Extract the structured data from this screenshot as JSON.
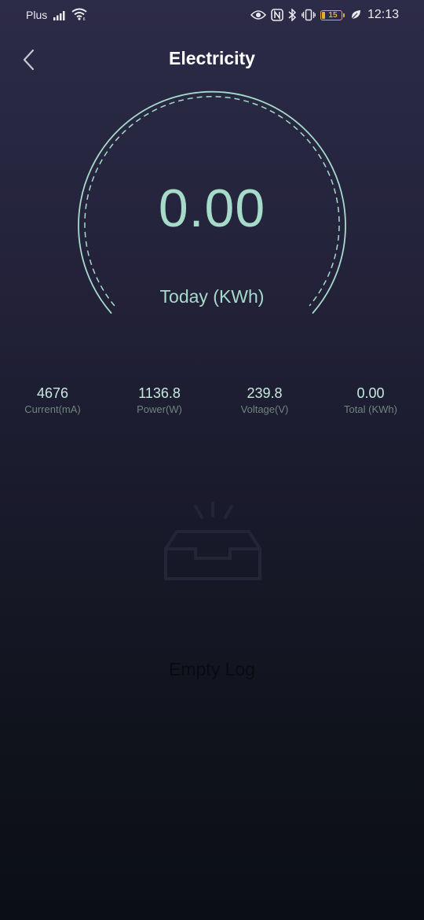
{
  "status_bar": {
    "carrier": "Plus",
    "battery_level": "15",
    "time": "12:13",
    "icons": [
      "signal-icon",
      "wifi-icon",
      "eye-icon",
      "nfc-icon",
      "bluetooth-icon",
      "vibrate-icon",
      "battery-icon",
      "leaf-icon"
    ],
    "battery_color": "#e7a93a"
  },
  "header": {
    "title": "Electricity",
    "back_icon": "chevron-left-icon"
  },
  "gauge": {
    "value": "0.00",
    "label": "Today (KWh)",
    "accent_color": "#a6dbc9"
  },
  "stats": [
    {
      "value": "4676",
      "label": "Current(mA)"
    },
    {
      "value": "1136.8",
      "label": "Power(W)"
    },
    {
      "value": "239.8",
      "label": "Voltage(V)"
    },
    {
      "value": "0.00",
      "label": "Total (KWh)"
    }
  ],
  "empty_state": {
    "icon": "empty-inbox-icon",
    "text": "Empty Log"
  }
}
